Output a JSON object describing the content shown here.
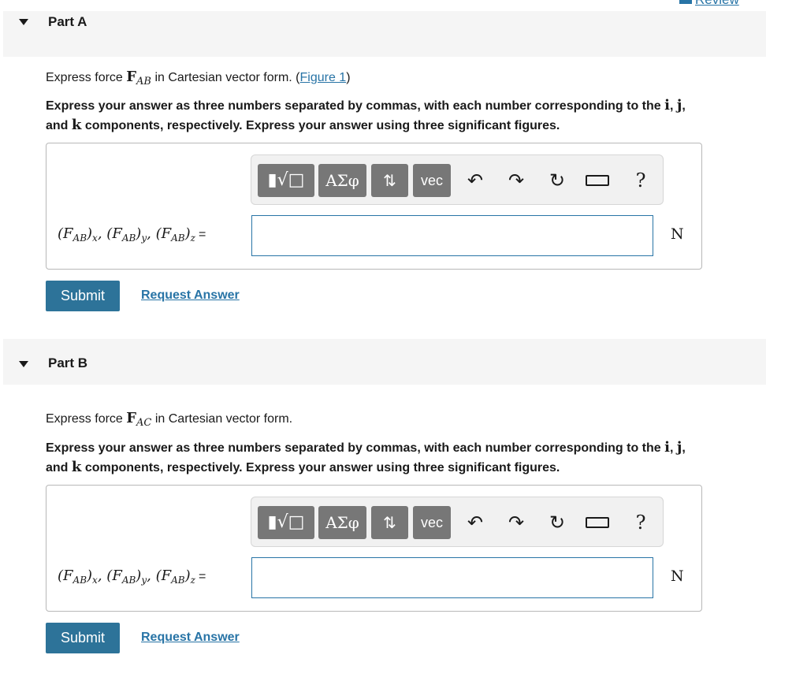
{
  "review": {
    "label": "Review"
  },
  "parts": [
    {
      "title": "Part A",
      "prompt_pre": "Express force ",
      "prompt_symbol": "F",
      "prompt_subscript": "AB",
      "prompt_post": " in Cartesian vector form. (",
      "figure_link": "Figure 1",
      "prompt_close": ")",
      "instructions_1": "Express your answer as three numbers separated by commas, with each number corresponding to the ",
      "instructions_i": "i",
      "instructions_2": ", ",
      "instructions_j": "j",
      "instructions_3": ",",
      "instructions_4": "and ",
      "instructions_k": "k",
      "instructions_5": " components, respectively. Express your answer using three significant figures.",
      "lhs": "(F",
      "answer_value": "",
      "unit": "N",
      "submit_label": "Submit",
      "request_label": "Request Answer"
    },
    {
      "title": "Part B",
      "prompt_pre": "Express force ",
      "prompt_symbol": "F",
      "prompt_subscript": "AC",
      "prompt_post": " in Cartesian vector form.",
      "instructions_1": "Express your answer as three numbers separated by commas, with each number corresponding to the ",
      "instructions_i": "i",
      "instructions_2": ", ",
      "instructions_j": "j",
      "instructions_3": ",",
      "instructions_4": "and ",
      "instructions_k": "k",
      "instructions_5": " components, respectively. Express your answer using three significant figures.",
      "answer_value": "",
      "unit": "N",
      "submit_label": "Submit",
      "request_label": "Request Answer"
    }
  ],
  "toolbar": {
    "template_glyph": "▮√□",
    "greek_label": "ΑΣφ",
    "arrows_glyph": "⇅",
    "vec_label": "vec",
    "undo_glyph": "↶",
    "redo_glyph": "↷",
    "reset_glyph": "↻",
    "help_label": "?"
  },
  "lhs": {
    "open": "(",
    "F": "F",
    "AB": "AB",
    "x": "x",
    "y": "y",
    "z": "z",
    "comma": ", ",
    "eq": "="
  }
}
